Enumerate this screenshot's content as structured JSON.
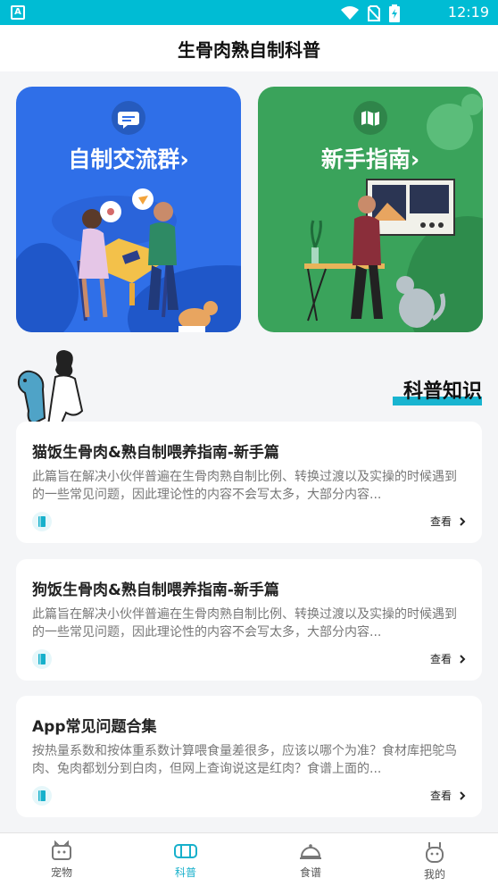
{
  "status_bar": {
    "time": "12:19",
    "left_badge": "A"
  },
  "app_bar": {
    "title": "生骨肉熟自制科普"
  },
  "features": [
    {
      "label": "自制交流群",
      "arrow": "›",
      "icon": "chat-icon",
      "color": "#2f6fe8"
    },
    {
      "label": "新手指南",
      "arrow": "›",
      "icon": "map-icon",
      "color": "#3aa35b"
    }
  ],
  "section": {
    "title": "科普知识",
    "accent": "#18b4d0"
  },
  "articles": [
    {
      "title": "猫饭生骨肉&熟自制喂养指南-新手篇",
      "desc": "此篇旨在解决小伙伴普遍在生骨肉熟自制比例、转换过渡以及实操的时候遇到的一些常见问题，因此理论性的内容不会写太多，大部分内容...",
      "view": "查看"
    },
    {
      "title": "狗饭生骨肉&熟自制喂养指南-新手篇",
      "desc": "此篇旨在解决小伙伴普遍在生骨肉熟自制比例、转换过渡以及实操的时候遇到的一些常见问题，因此理论性的内容不会写太多，大部分内容...",
      "view": "查看"
    },
    {
      "title": "App常见问题合集",
      "desc": "按热量系数和按体重系数计算喂食量差很多，应该以哪个为准？食材库把鸵鸟肉、兔肉都划分到白肉，但网上查询说这是红肉？食谱上面的...",
      "view": "查看"
    }
  ],
  "bottom_nav": [
    {
      "label": "宠物",
      "icon": "pet-icon",
      "active": false
    },
    {
      "label": "科普",
      "icon": "science-icon",
      "active": true
    },
    {
      "label": "食谱",
      "icon": "dish-icon",
      "active": false
    },
    {
      "label": "我的",
      "icon": "profile-icon",
      "active": false
    }
  ],
  "colors": {
    "status_bar": "#00bcd4",
    "accent": "#17b0cb",
    "background": "#f4f5f7"
  }
}
